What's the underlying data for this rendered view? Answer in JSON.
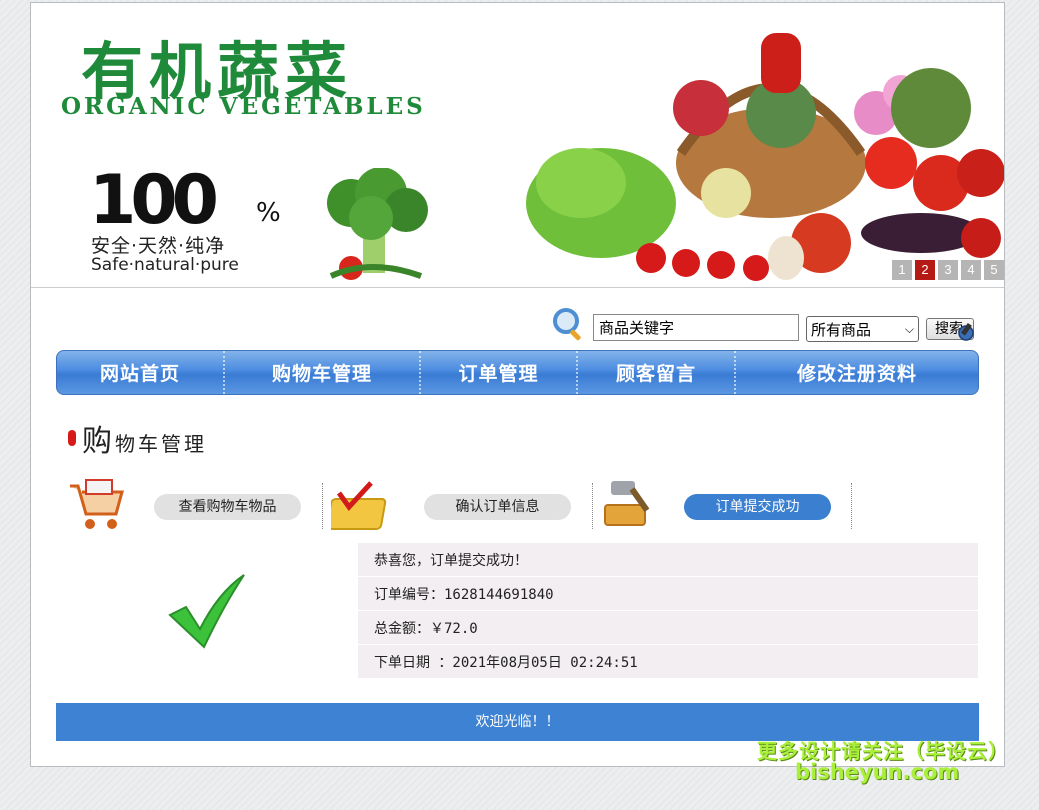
{
  "banner": {
    "title": "有机蔬菜",
    "subtitle": "ORGANIC VEGETABLES",
    "badge_number": "100",
    "badge_percent": "%",
    "badge_cn": "安全·天然·纯净",
    "badge_en": "Safe·natural·pure",
    "slides": [
      "1",
      "2",
      "3",
      "4",
      "5"
    ],
    "active_slide": 2
  },
  "search": {
    "value": "商品关键字",
    "category_selected": "所有商品",
    "button_label": "搜索"
  },
  "nav": {
    "items": [
      "网站首页",
      "购物车管理",
      "订单管理",
      "顾客留言",
      "修改注册资料"
    ]
  },
  "section": {
    "heading_first": "购",
    "heading_rest": "物车管理"
  },
  "steps": [
    {
      "label": "查看购物车物品",
      "active": false
    },
    {
      "label": "确认订单信息",
      "active": false
    },
    {
      "label": "订单提交成功",
      "active": true
    }
  ],
  "result": {
    "message": "恭喜您，订单提交成功！",
    "order_no": "订单编号：1628144691840",
    "total": "总金额：￥72.0",
    "order_date": "下单日期 ：2021年08月05日 02:24:51"
  },
  "footer": {
    "text": "欢迎光临！！"
  },
  "watermark": {
    "line1": "更多设计请关注（毕设云）",
    "line2": "bisheyun.com"
  },
  "colors": {
    "brand_green": "#1e8a3a",
    "nav_blue": "#4b8be0",
    "footer_blue": "#3e83d3",
    "active_step": "#3b7fd1"
  }
}
